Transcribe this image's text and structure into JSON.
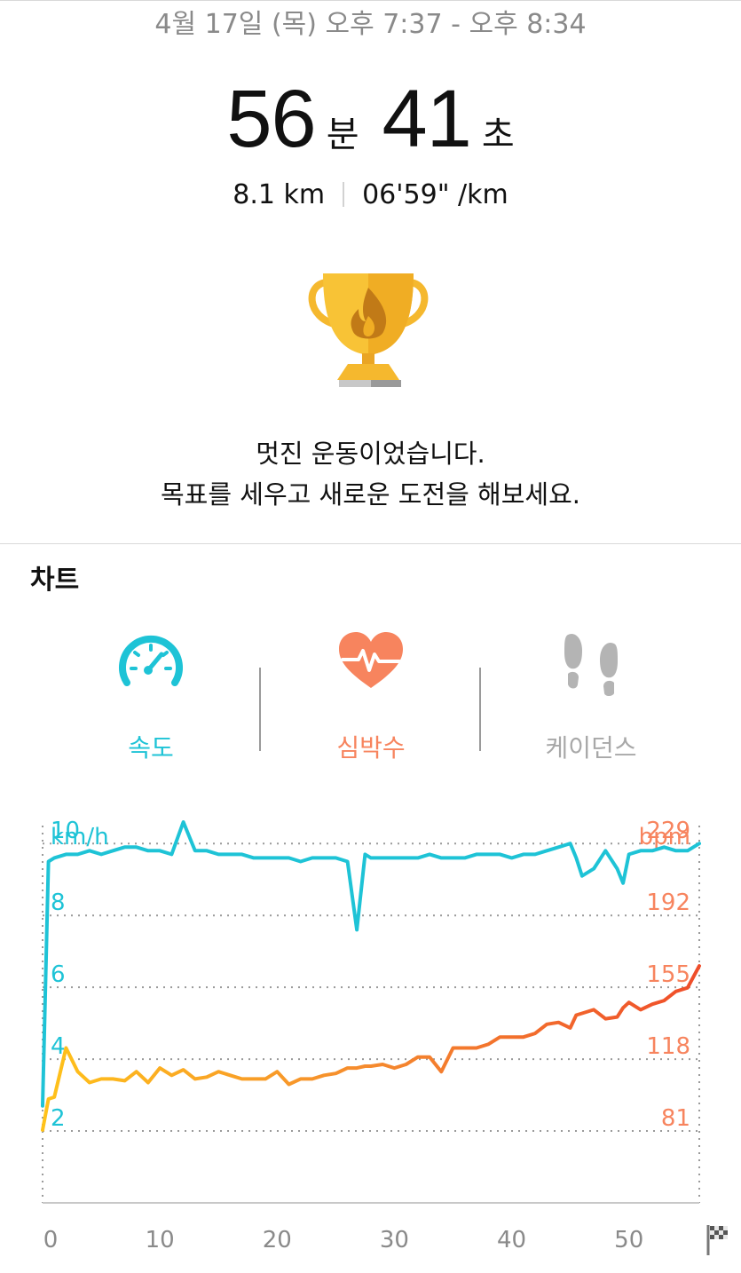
{
  "header": {
    "date_range": "4월 17일 (목) 오후 7:37 - 오후 8:34",
    "duration": {
      "minutes": "56",
      "minutes_unit": "분",
      "seconds": "41",
      "seconds_unit": "초"
    },
    "distance": "8.1 km",
    "pace": "06'59\" /km"
  },
  "trophy": {
    "icon": "trophy-flame-icon"
  },
  "message": {
    "line1": "멋진 운동이었습니다.",
    "line2": "목표를 세우고 새로운 도전을 해보세요."
  },
  "chart_section": {
    "title": "차트",
    "tabs": [
      {
        "label": "속도",
        "icon": "speedometer-icon",
        "color": "#1ec3d6",
        "active": true
      },
      {
        "label": "심박수",
        "icon": "heart-rate-icon",
        "color": "#f7845e"
      },
      {
        "label": "케이던스",
        "icon": "footsteps-icon",
        "color": "#a8a8a8"
      }
    ]
  },
  "colors": {
    "speed": "#1ec3d6",
    "heart_rate": "#f7845e",
    "grid": "#9a9a9a"
  },
  "chart_data": {
    "type": "line",
    "x": [
      0,
      0.5,
      1,
      2,
      3,
      4,
      5,
      6,
      7,
      8,
      9,
      10,
      11,
      12,
      13,
      14,
      15,
      16,
      17,
      18,
      19,
      20,
      21,
      22,
      23,
      24,
      25,
      26,
      26.8,
      27.5,
      28,
      29,
      30,
      31,
      32,
      33,
      34,
      35,
      36,
      37,
      38,
      39,
      40,
      41,
      42,
      43,
      44,
      45,
      45.5,
      46,
      47,
      48,
      49,
      49.5,
      50,
      51,
      52,
      53,
      54,
      55,
      56
    ],
    "xlim": [
      0,
      56
    ],
    "x_ticks": [
      "0",
      "10",
      "20",
      "30",
      "40",
      "50"
    ],
    "finish_icon": "checkered-flag-icon",
    "left_axis": {
      "unit": "km/h",
      "ticks": [
        "10",
        "8",
        "6",
        "4",
        "2"
      ],
      "ylim": [
        0,
        10.5
      ]
    },
    "right_axis": {
      "unit": "bpm",
      "ticks": [
        "229",
        "192",
        "155",
        "118",
        "81"
      ],
      "ylim": [
        40,
        247
      ]
    },
    "series": [
      {
        "name": "km/h",
        "axis": "left",
        "values": [
          2.7,
          9.5,
          9.6,
          9.7,
          9.7,
          9.8,
          9.7,
          9.8,
          9.9,
          9.9,
          9.8,
          9.8,
          9.7,
          10.6,
          9.8,
          9.8,
          9.7,
          9.7,
          9.7,
          9.6,
          9.6,
          9.6,
          9.6,
          9.5,
          9.6,
          9.6,
          9.6,
          9.5,
          7.6,
          9.7,
          9.6,
          9.6,
          9.6,
          9.6,
          9.6,
          9.7,
          9.6,
          9.6,
          9.6,
          9.7,
          9.7,
          9.7,
          9.6,
          9.7,
          9.7,
          9.8,
          9.9,
          10.0,
          9.6,
          9.1,
          9.3,
          9.8,
          9.3,
          8.9,
          9.7,
          9.8,
          9.8,
          9.9,
          9.8,
          9.8,
          10.0
        ]
      },
      {
        "name": "bpm",
        "axis": "right",
        "values": [
          80,
          97,
          98,
          125,
          112,
          106,
          108,
          108,
          107,
          112,
          106,
          114,
          110,
          113,
          108,
          109,
          112,
          110,
          108,
          108,
          108,
          112,
          105,
          108,
          108,
          110,
          111,
          114,
          114,
          115,
          115,
          116,
          114,
          116,
          120,
          120,
          112,
          125,
          125,
          125,
          127,
          131,
          131,
          131,
          133,
          138,
          139,
          136,
          143,
          144,
          146,
          141,
          142,
          147,
          150,
          146,
          149,
          151,
          156,
          158,
          170
        ]
      }
    ]
  }
}
